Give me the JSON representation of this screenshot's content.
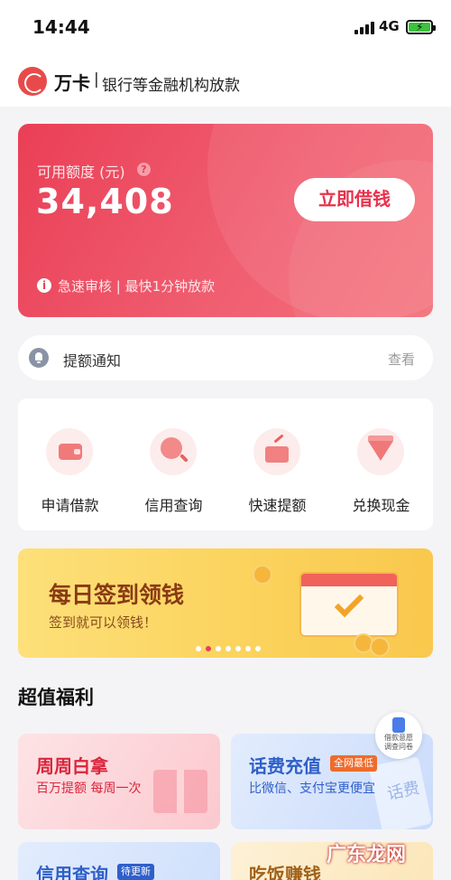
{
  "status_bar": {
    "time": "14:44",
    "network": "4G"
  },
  "header": {
    "brand": "万卡",
    "separator": "|",
    "tagline": "银行等金融机构放款"
  },
  "credit_card": {
    "label": "可用额度 (元)",
    "help_icon": "question-icon",
    "amount": "34,408",
    "borrow_button": "立即借钱",
    "review_text": "急速审核 | 最快1分钟放款"
  },
  "notice": {
    "text": "提额通知",
    "view": "查看",
    "icon": "bell-icon"
  },
  "services": [
    {
      "label": "申请借款",
      "icon": "wallet-icon"
    },
    {
      "label": "信用查询",
      "icon": "magnifier-icon"
    },
    {
      "label": "快速提额",
      "icon": "card-arrow-icon"
    },
    {
      "label": "兑换现金",
      "icon": "diamond-icon"
    }
  ],
  "banner": {
    "title": "每日签到领钱",
    "subtitle": "签到就可以领钱！",
    "page_count": 7,
    "active_page": 2
  },
  "section_title": "超值福利",
  "feedback": {
    "line1": "借款意愿",
    "line2": "调查问卷"
  },
  "promos": [
    {
      "title": "周周白拿",
      "subtitle": "百万提额 每周一次"
    },
    {
      "title": "话费充值",
      "tag": "全网最低",
      "subtitle": "比微信、支付宝更便宜",
      "card_text": "话费"
    },
    {
      "title": "信用查询",
      "tag": "待更新"
    },
    {
      "title": "吃饭赚钱"
    }
  ],
  "watermark": "广东龙网",
  "colors": {
    "primary_red": "#ea3f56",
    "banner_yellow": "#fbd35d",
    "promo_red_text": "#d9263d",
    "promo_blue_text": "#2f5fc9"
  }
}
